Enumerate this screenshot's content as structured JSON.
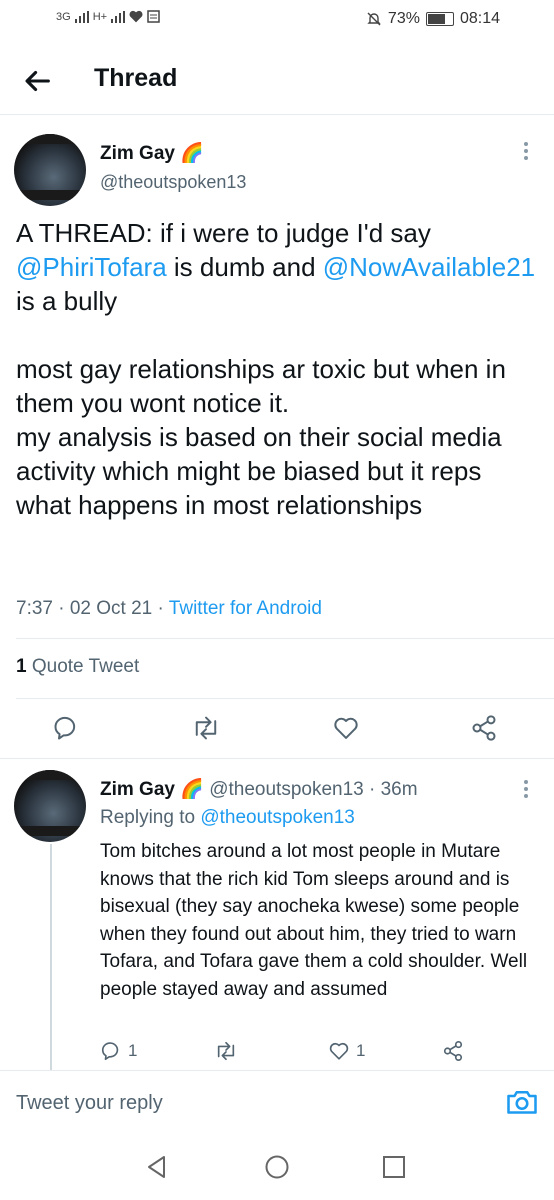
{
  "status_bar": {
    "network": "3G",
    "network2": "H+",
    "battery_percent": "73%",
    "battery_level": 0.73,
    "time": "08:14"
  },
  "header": {
    "title": "Thread"
  },
  "main_tweet": {
    "name": "Zim Gay",
    "name_emoji": "🌈",
    "handle": "@theoutspoken13",
    "text_part1": "A THREAD: if i were to judge I'd say ",
    "mention1": "@PhiriTofara",
    "text_part2": " is dumb and ",
    "mention2": "@NowAvailable21",
    "text_part3": " is a bully\n\nmost gay relationships ar toxic but when in them you wont notice it.\nmy analysis is based on their social media activity which might be biased but it reps what happens in most relationships",
    "time": "7:37 · 02 Oct 21 · ",
    "source": "Twitter for Android",
    "quote_count": "1",
    "quote_label": " Quote Tweet"
  },
  "reply_tweet": {
    "name": "Zim Gay",
    "name_emoji": "🌈",
    "handle": " @theoutspoken13 · 36m",
    "replying_label": "Replying to ",
    "replying_handle": "@theoutspoken13",
    "text": "Tom bitches around a lot most people in Mutare knows that the rich kid Tom sleeps around and is bisexual (they say anocheka kwese) some people when they found out about him, they tried to warn Tofara, and Tofara gave them a cold shoulder. Well people stayed away and assumed",
    "reply_count": "1",
    "like_count": "1"
  },
  "reply_box": {
    "placeholder": "Tweet your reply"
  },
  "icons": {
    "accent": "#1d9bf0",
    "secondary": "#536471"
  }
}
